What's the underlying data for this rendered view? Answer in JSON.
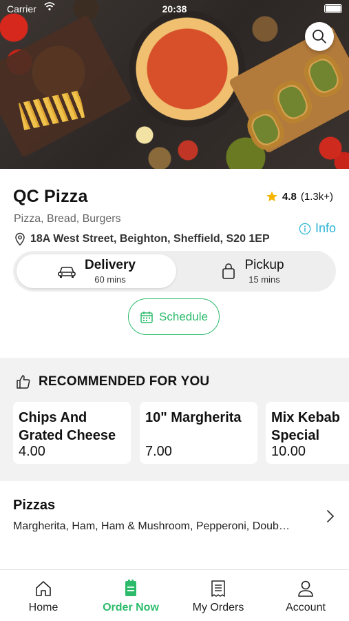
{
  "status_bar": {
    "carrier": "Carrier",
    "time": "20:38"
  },
  "colors": {
    "accent": "#2bbb6b",
    "info": "#2bb3d6",
    "star": "#f5b400"
  },
  "restaurant": {
    "name": "QC Pizza",
    "rating": "4.8",
    "rating_count": "(1.3k+)",
    "cuisine": "Pizza, Bread, Burgers",
    "info_label": "Info",
    "address": "18A West Street, Beighton, Sheffield, S20 1EP"
  },
  "order_type": {
    "delivery": {
      "label": "Delivery",
      "time": "60 mins",
      "selected": true
    },
    "pickup": {
      "label": "Pickup",
      "time": "15 mins",
      "selected": false
    }
  },
  "schedule_label": "Schedule",
  "recommended": {
    "heading": "RECOMMENDED FOR YOU",
    "items": [
      {
        "name": "Chips And Grated Cheese",
        "price": "4.00"
      },
      {
        "name": "10\" Margherita",
        "price": "7.00"
      },
      {
        "name": "Mix Kebab Special",
        "price": "10.00"
      }
    ]
  },
  "category": {
    "title": "Pizzas",
    "items": "Margherita, Ham, Ham & Mushroom, Pepperoni, Doub…"
  },
  "tabs": [
    {
      "label": "Home",
      "icon": "home-icon"
    },
    {
      "label": "Order Now",
      "icon": "order-icon",
      "active": true
    },
    {
      "label": "My Orders",
      "icon": "receipt-icon"
    },
    {
      "label": "Account",
      "icon": "account-icon"
    }
  ]
}
